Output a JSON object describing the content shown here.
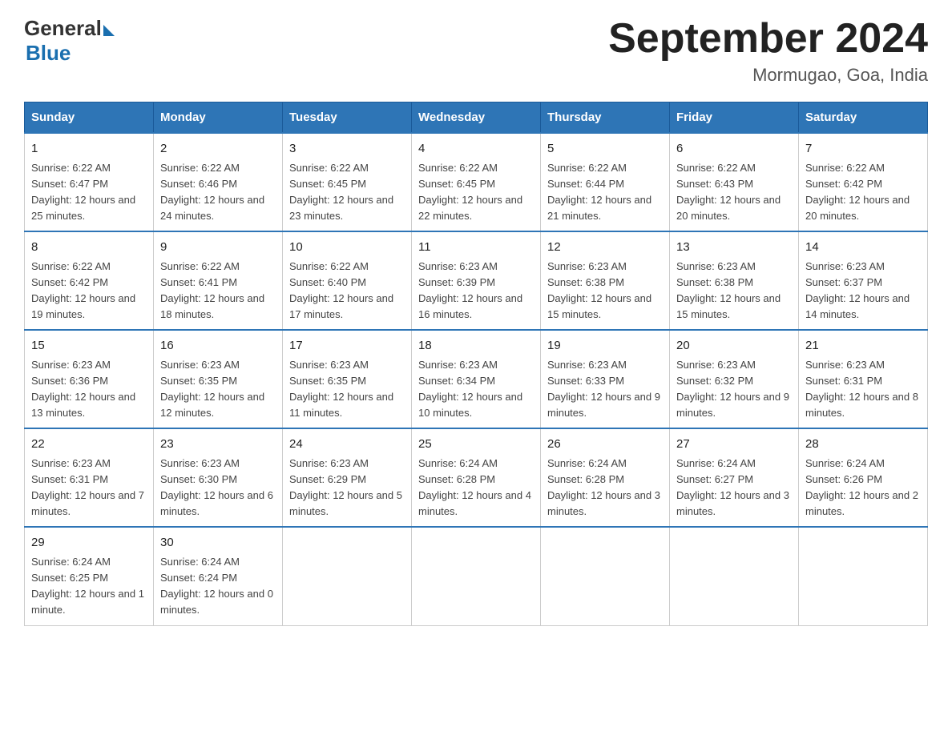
{
  "header": {
    "logo_general": "General",
    "logo_blue": "Blue",
    "title": "September 2024",
    "subtitle": "Mormugao, Goa, India"
  },
  "columns": [
    "Sunday",
    "Monday",
    "Tuesday",
    "Wednesday",
    "Thursday",
    "Friday",
    "Saturday"
  ],
  "weeks": [
    [
      {
        "day": "1",
        "sunrise": "Sunrise: 6:22 AM",
        "sunset": "Sunset: 6:47 PM",
        "daylight": "Daylight: 12 hours and 25 minutes."
      },
      {
        "day": "2",
        "sunrise": "Sunrise: 6:22 AM",
        "sunset": "Sunset: 6:46 PM",
        "daylight": "Daylight: 12 hours and 24 minutes."
      },
      {
        "day": "3",
        "sunrise": "Sunrise: 6:22 AM",
        "sunset": "Sunset: 6:45 PM",
        "daylight": "Daylight: 12 hours and 23 minutes."
      },
      {
        "day": "4",
        "sunrise": "Sunrise: 6:22 AM",
        "sunset": "Sunset: 6:45 PM",
        "daylight": "Daylight: 12 hours and 22 minutes."
      },
      {
        "day": "5",
        "sunrise": "Sunrise: 6:22 AM",
        "sunset": "Sunset: 6:44 PM",
        "daylight": "Daylight: 12 hours and 21 minutes."
      },
      {
        "day": "6",
        "sunrise": "Sunrise: 6:22 AM",
        "sunset": "Sunset: 6:43 PM",
        "daylight": "Daylight: 12 hours and 20 minutes."
      },
      {
        "day": "7",
        "sunrise": "Sunrise: 6:22 AM",
        "sunset": "Sunset: 6:42 PM",
        "daylight": "Daylight: 12 hours and 20 minutes."
      }
    ],
    [
      {
        "day": "8",
        "sunrise": "Sunrise: 6:22 AM",
        "sunset": "Sunset: 6:42 PM",
        "daylight": "Daylight: 12 hours and 19 minutes."
      },
      {
        "day": "9",
        "sunrise": "Sunrise: 6:22 AM",
        "sunset": "Sunset: 6:41 PM",
        "daylight": "Daylight: 12 hours and 18 minutes."
      },
      {
        "day": "10",
        "sunrise": "Sunrise: 6:22 AM",
        "sunset": "Sunset: 6:40 PM",
        "daylight": "Daylight: 12 hours and 17 minutes."
      },
      {
        "day": "11",
        "sunrise": "Sunrise: 6:23 AM",
        "sunset": "Sunset: 6:39 PM",
        "daylight": "Daylight: 12 hours and 16 minutes."
      },
      {
        "day": "12",
        "sunrise": "Sunrise: 6:23 AM",
        "sunset": "Sunset: 6:38 PM",
        "daylight": "Daylight: 12 hours and 15 minutes."
      },
      {
        "day": "13",
        "sunrise": "Sunrise: 6:23 AM",
        "sunset": "Sunset: 6:38 PM",
        "daylight": "Daylight: 12 hours and 15 minutes."
      },
      {
        "day": "14",
        "sunrise": "Sunrise: 6:23 AM",
        "sunset": "Sunset: 6:37 PM",
        "daylight": "Daylight: 12 hours and 14 minutes."
      }
    ],
    [
      {
        "day": "15",
        "sunrise": "Sunrise: 6:23 AM",
        "sunset": "Sunset: 6:36 PM",
        "daylight": "Daylight: 12 hours and 13 minutes."
      },
      {
        "day": "16",
        "sunrise": "Sunrise: 6:23 AM",
        "sunset": "Sunset: 6:35 PM",
        "daylight": "Daylight: 12 hours and 12 minutes."
      },
      {
        "day": "17",
        "sunrise": "Sunrise: 6:23 AM",
        "sunset": "Sunset: 6:35 PM",
        "daylight": "Daylight: 12 hours and 11 minutes."
      },
      {
        "day": "18",
        "sunrise": "Sunrise: 6:23 AM",
        "sunset": "Sunset: 6:34 PM",
        "daylight": "Daylight: 12 hours and 10 minutes."
      },
      {
        "day": "19",
        "sunrise": "Sunrise: 6:23 AM",
        "sunset": "Sunset: 6:33 PM",
        "daylight": "Daylight: 12 hours and 9 minutes."
      },
      {
        "day": "20",
        "sunrise": "Sunrise: 6:23 AM",
        "sunset": "Sunset: 6:32 PM",
        "daylight": "Daylight: 12 hours and 9 minutes."
      },
      {
        "day": "21",
        "sunrise": "Sunrise: 6:23 AM",
        "sunset": "Sunset: 6:31 PM",
        "daylight": "Daylight: 12 hours and 8 minutes."
      }
    ],
    [
      {
        "day": "22",
        "sunrise": "Sunrise: 6:23 AM",
        "sunset": "Sunset: 6:31 PM",
        "daylight": "Daylight: 12 hours and 7 minutes."
      },
      {
        "day": "23",
        "sunrise": "Sunrise: 6:23 AM",
        "sunset": "Sunset: 6:30 PM",
        "daylight": "Daylight: 12 hours and 6 minutes."
      },
      {
        "day": "24",
        "sunrise": "Sunrise: 6:23 AM",
        "sunset": "Sunset: 6:29 PM",
        "daylight": "Daylight: 12 hours and 5 minutes."
      },
      {
        "day": "25",
        "sunrise": "Sunrise: 6:24 AM",
        "sunset": "Sunset: 6:28 PM",
        "daylight": "Daylight: 12 hours and 4 minutes."
      },
      {
        "day": "26",
        "sunrise": "Sunrise: 6:24 AM",
        "sunset": "Sunset: 6:28 PM",
        "daylight": "Daylight: 12 hours and 3 minutes."
      },
      {
        "day": "27",
        "sunrise": "Sunrise: 6:24 AM",
        "sunset": "Sunset: 6:27 PM",
        "daylight": "Daylight: 12 hours and 3 minutes."
      },
      {
        "day": "28",
        "sunrise": "Sunrise: 6:24 AM",
        "sunset": "Sunset: 6:26 PM",
        "daylight": "Daylight: 12 hours and 2 minutes."
      }
    ],
    [
      {
        "day": "29",
        "sunrise": "Sunrise: 6:24 AM",
        "sunset": "Sunset: 6:25 PM",
        "daylight": "Daylight: 12 hours and 1 minute."
      },
      {
        "day": "30",
        "sunrise": "Sunrise: 6:24 AM",
        "sunset": "Sunset: 6:24 PM",
        "daylight": "Daylight: 12 hours and 0 minutes."
      },
      null,
      null,
      null,
      null,
      null
    ]
  ]
}
